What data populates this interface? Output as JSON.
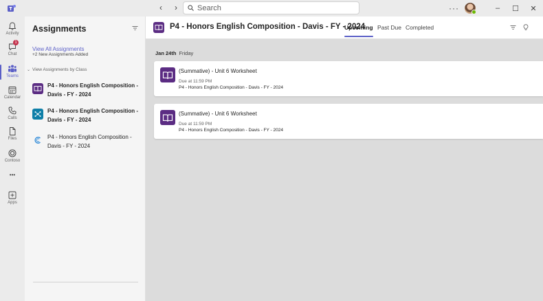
{
  "titlebar": {
    "search_placeholder": "Search",
    "back_glyph": "‹",
    "forward_glyph": "›",
    "more_glyph": "···",
    "minimize_glyph": "–",
    "maximize_glyph": "☐",
    "close_glyph": "✕"
  },
  "rail": {
    "items": [
      {
        "label": "Activity",
        "icon": "bell-icon"
      },
      {
        "label": "Chat",
        "icon": "chat-icon",
        "badge": "1"
      },
      {
        "label": "Teams",
        "icon": "teams-icon",
        "active": true
      },
      {
        "label": "Calendar",
        "icon": "calendar-icon"
      },
      {
        "label": "Calls",
        "icon": "phone-icon"
      },
      {
        "label": "Files",
        "icon": "file-icon"
      },
      {
        "label": "Contoso",
        "icon": "contoso-icon"
      },
      {
        "label": "Apps",
        "icon": "add-apps-icon"
      }
    ],
    "more_glyph": "•••"
  },
  "panel": {
    "title": "Assignments",
    "view_all": "View All Assignments",
    "new_added": "+2 New Assignments Added",
    "by_class": "View Assignments by Class",
    "classes": [
      {
        "name": "P4 - Honors English Composition - Davis - FY - 2024",
        "icon": "book-icon",
        "bold": true
      },
      {
        "name": "P4 - Honors English Composition - Davis - FY - 2024",
        "icon": "molecule-icon",
        "bold": true
      },
      {
        "name": "P4 - Honors English Composition - Davis - FY - 2024",
        "icon": "letter-c-icon",
        "bold": false
      }
    ]
  },
  "main": {
    "title": "P4 - Honors English Composition - Davis - FY - 2024",
    "tabs": [
      "Upcoming",
      "Past Due",
      "Completed"
    ],
    "active_tab": "Upcoming",
    "date_group": {
      "date": "Jan 24th",
      "day": "Friday"
    },
    "assignments": [
      {
        "title": "(Summative) - Unit 6 Worksheet",
        "due": "Due at 11:59 PM",
        "class": "P4 - Honors English Composition - Davis - FY - 2024"
      },
      {
        "title": "(Summative) - Unit 6 Worksheet",
        "due": "Due at 11:59 PM",
        "class": "P4 - Honors English Composition - Davis - FY - 2024"
      }
    ]
  },
  "colors": {
    "accent": "#5b5fc7",
    "class_purple": "#5b2c83",
    "class_teal": "#0f7fa8",
    "badge_red": "#c4314b"
  }
}
